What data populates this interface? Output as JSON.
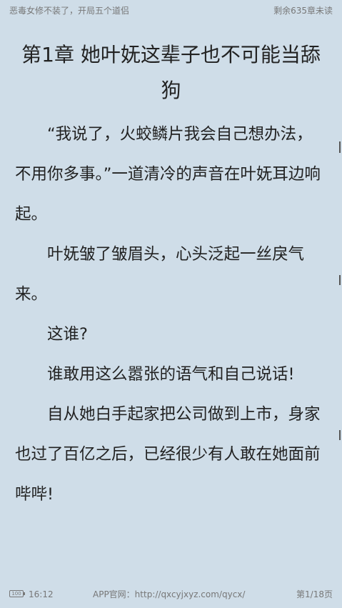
{
  "header": {
    "book_title": "恶毒女修不装了，开局五个道侣",
    "remaining": "剩余635章未读"
  },
  "chapter": {
    "title": "第1章 她叶妩这辈子也不可能当舔狗",
    "paragraphs": [
      "“我说了，火蛟鳞片我会自己想办法，不用你多事。”一道清冷的声音在叶妩耳边响起。",
      "叶妩皱了皱眉头，心头泛起一丝戾气来。",
      "这谁?",
      "谁敢用这么嚣张的语气和自己说话!",
      "自从她白手起家把公司做到上市，身家也过了百亿之后，已经很少有人敢在她面前哔哔!"
    ]
  },
  "footer": {
    "battery": "100",
    "time": "16:12",
    "app_url": "APP官网：http://qxcyjxyz.com/qycx/",
    "page": "第1/18页"
  }
}
